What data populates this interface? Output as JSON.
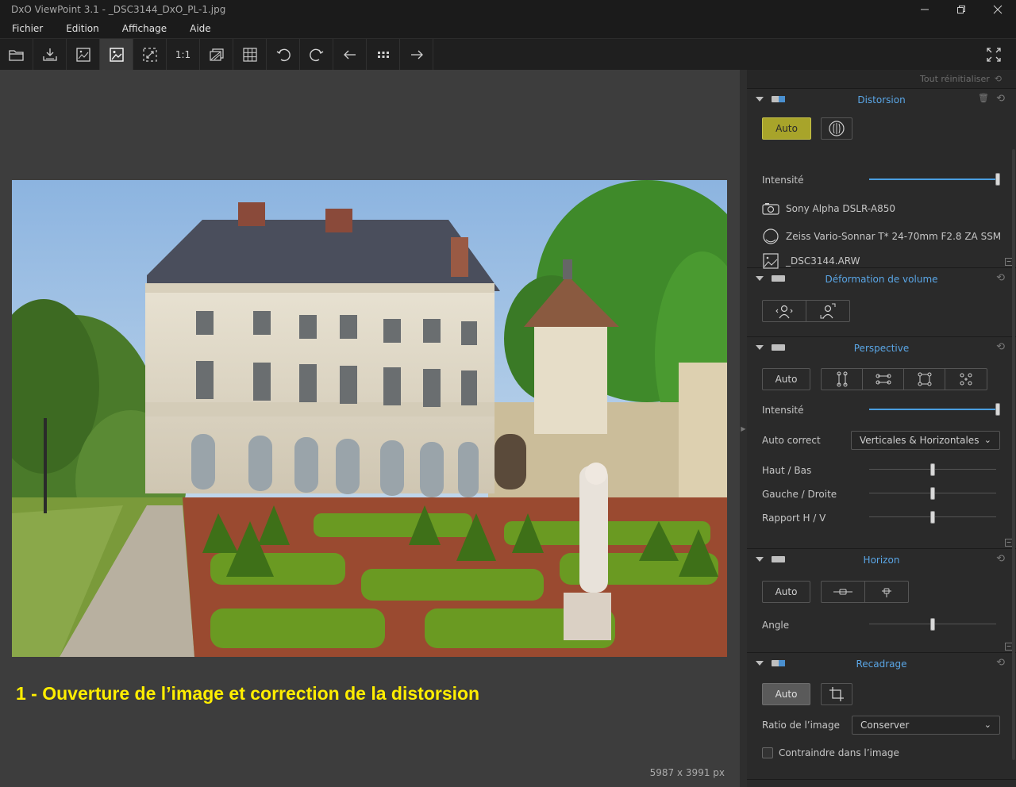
{
  "window": {
    "title": "DxO ViewPoint 3.1 - _DSC3144_DxO_PL-1.jpg"
  },
  "menu": [
    "Fichier",
    "Edition",
    "Affichage",
    "Aide"
  ],
  "toolbar": {
    "one_to_one": "1:1"
  },
  "canvas": {
    "caption": "1 - Ouverture de l’image et correction de la distorsion",
    "dimensions": "5987 x 3991 px"
  },
  "panel": {
    "reset_all": "Tout réinitialiser",
    "distorsion": {
      "title": "Distorsion",
      "auto_label": "Auto",
      "intensity_label": "Intensité",
      "intensity_value": 1.0,
      "camera": "Sony Alpha DSLR-A850",
      "lens": "Zeiss Vario-Sonnar T* 24-70mm F2.8 ZA SSM",
      "file": "_DSC3144.ARW"
    },
    "volume": {
      "title": "Déformation de volume"
    },
    "perspective": {
      "title": "Perspective",
      "auto_label": "Auto",
      "intensity_label": "Intensité",
      "intensity_value": 1.0,
      "autocorrect_label": "Auto correct",
      "autocorrect_value": "Verticales & Horizontales",
      "haut_bas_label": "Haut / Bas",
      "gauche_droite_label": "Gauche / Droite",
      "rapport_label": "Rapport H / V"
    },
    "horizon": {
      "title": "Horizon",
      "auto_label": "Auto",
      "angle_label": "Angle"
    },
    "recadrage": {
      "title": "Recadrage",
      "auto_label": "Auto",
      "ratio_label": "Ratio de l’image",
      "ratio_value": "Conserver",
      "constrain_label": "Contraindre dans l’image"
    }
  }
}
